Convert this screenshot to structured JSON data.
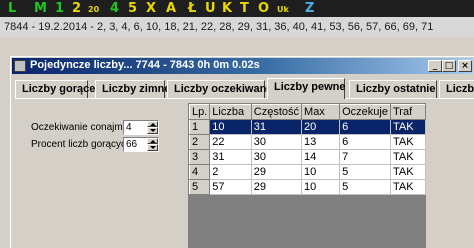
{
  "toolbar": {
    "icons": [
      {
        "label": "L",
        "color": "#21c521"
      },
      {
        "label": "M",
        "color": "#21c521"
      },
      {
        "label": "1",
        "color": "#21c521"
      },
      {
        "label": "2",
        "color": "#e8d800"
      },
      {
        "label": "20",
        "color": "#e8d800"
      },
      {
        "label": "4",
        "color": "#21c521"
      },
      {
        "label": "5",
        "color": "#e8d800"
      },
      {
        "label": "X",
        "color": "#e8d800"
      },
      {
        "label": "A",
        "color": "#e8d800"
      },
      {
        "label": "Ł",
        "color": "#e8d800"
      },
      {
        "label": "U",
        "color": "#e8d800"
      },
      {
        "label": "K",
        "color": "#e8d800"
      },
      {
        "label": "T",
        "color": "#e8d800"
      },
      {
        "label": "O",
        "color": "#e8d800"
      },
      {
        "label": "Uk",
        "color": "#e8d800"
      },
      {
        "label": "Z",
        "color": "#4ab0e6"
      }
    ]
  },
  "numbers_line": "7844 - 19.2.2014 - 2, 3, 4, 6, 10, 18, 21, 22, 28, 29, 31, 36, 40, 41, 53, 56, 57, 66, 69, 71",
  "window": {
    "title": "Pojedyncze liczby... 7744 - 7843   0h 0m 0.02s",
    "minimize": "_",
    "maximize": "□",
    "close": "×"
  },
  "tabs": [
    {
      "label": "Liczby gorące",
      "active": false
    },
    {
      "label": "Liczby zimne",
      "active": false
    },
    {
      "label": "Liczby oczekiwane",
      "active": false
    },
    {
      "label": "Liczby pewne",
      "active": true
    },
    {
      "label": "Liczby ostatnie",
      "active": false
    },
    {
      "label": "Liczby",
      "active": false
    }
  ],
  "form": {
    "expectation_label": "Oczekiwanie conajmniej:",
    "expectation_value": "4",
    "hot_percent_label": "Procent liczb gorących:",
    "hot_percent_value": "66"
  },
  "grid": {
    "headers": [
      "Lp.",
      "Liczba",
      "Częstość",
      "Max",
      "Oczekuje",
      "Traf"
    ],
    "rows": [
      [
        "1",
        "10",
        "31",
        "20",
        "6",
        "TAK"
      ],
      [
        "2",
        "22",
        "30",
        "13",
        "6",
        "TAK"
      ],
      [
        "3",
        "31",
        "30",
        "14",
        "7",
        "TAK"
      ],
      [
        "4",
        "2",
        "29",
        "10",
        "5",
        "TAK"
      ],
      [
        "5",
        "57",
        "29",
        "10",
        "5",
        "TAK"
      ]
    ],
    "selected_row": 0
  }
}
